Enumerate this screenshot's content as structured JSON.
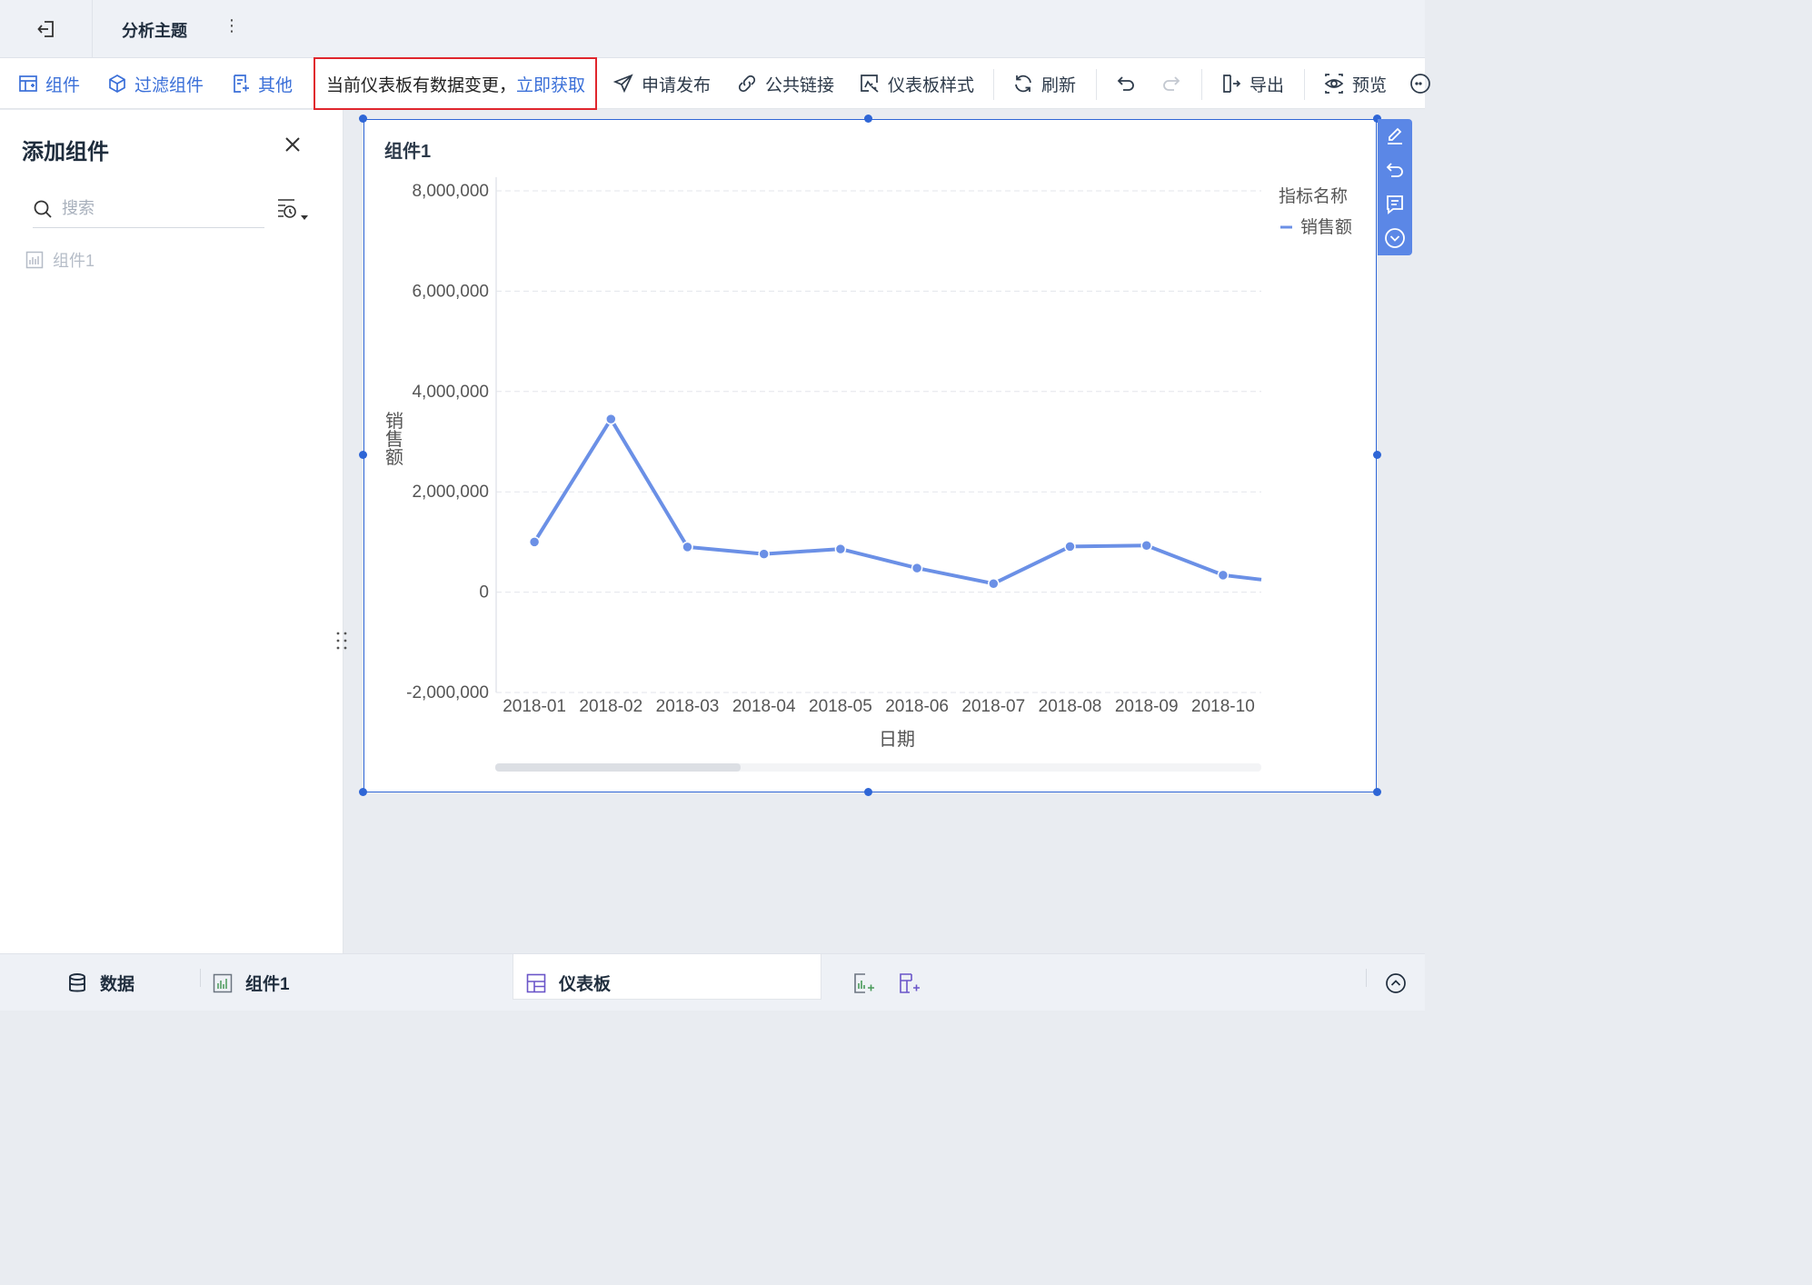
{
  "topbar": {
    "title": "分析主题",
    "more": "⋮"
  },
  "toolbar": {
    "component": "组件",
    "filter_component": "过滤组件",
    "other": "其他",
    "notice_text": "当前仪表板有数据变更，",
    "notice_link": "立即获取",
    "publish": "申请发布",
    "public_link": "公共链接",
    "dashboard_style": "仪表板样式",
    "refresh": "刷新",
    "export": "导出",
    "preview": "预览"
  },
  "left_panel": {
    "title": "添加组件",
    "search_placeholder": "搜索",
    "items": [
      "组件1"
    ]
  },
  "widget": {
    "title": "组件1"
  },
  "chart_data": {
    "type": "line",
    "title": "",
    "xlabel": "日期",
    "ylabel": "销售额",
    "legend_title": "指标名称",
    "legend_position": "top-right",
    "grid": true,
    "ylim": [
      -2000000,
      8000000
    ],
    "yticks": [
      -2000000,
      0,
      2000000,
      4000000,
      6000000,
      8000000
    ],
    "ytick_labels": [
      "-2,000,000",
      "0",
      "2,000,000",
      "4,000,000",
      "6,000,000",
      "8,000,000"
    ],
    "categories": [
      "2018-01",
      "2018-02",
      "2018-03",
      "2018-04",
      "2018-05",
      "2018-06",
      "2018-07",
      "2018-08",
      "2018-09",
      "2018-10"
    ],
    "series": [
      {
        "name": "销售额",
        "color": "#6b90e6",
        "values": [
          1000000,
          3450000,
          900000,
          760000,
          860000,
          480000,
          170000,
          910000,
          930000,
          340000
        ]
      }
    ]
  },
  "bottombar": {
    "data": "数据",
    "component": "组件1",
    "dashboard": "仪表板"
  }
}
